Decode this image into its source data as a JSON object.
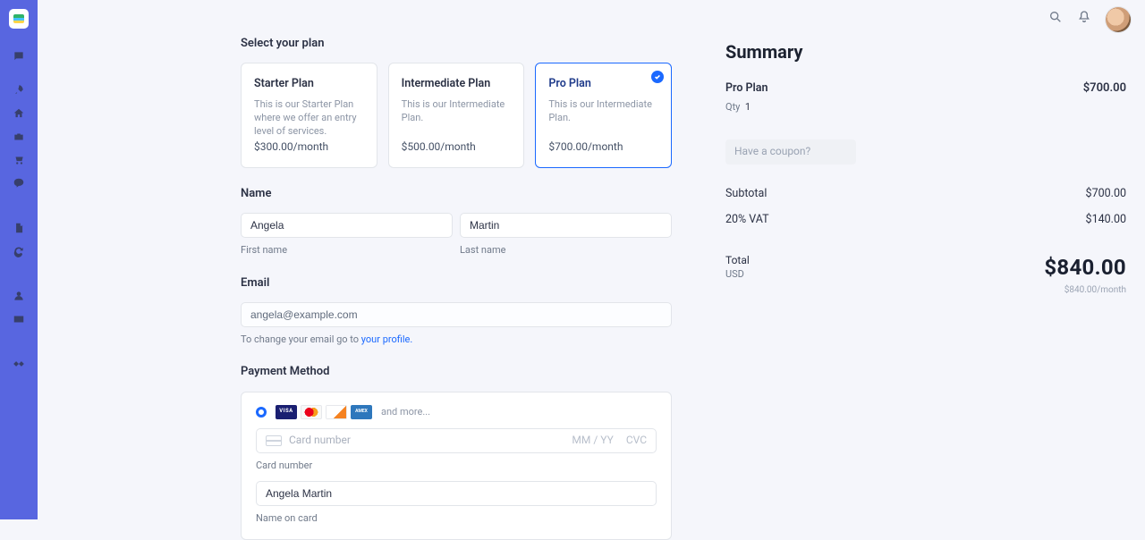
{
  "plan_section_title": "Select your plan",
  "plans": [
    {
      "title": "Starter Plan",
      "desc": "This is our Starter Plan where we offer an entry level of services.",
      "price": "$300.00/month",
      "selected": false
    },
    {
      "title": "Intermediate Plan",
      "desc": "This is our Intermediate Plan.",
      "price": "$500.00/month",
      "selected": false
    },
    {
      "title": "Pro Plan",
      "desc": "This is our Intermediate Plan.",
      "price": "$700.00/month",
      "selected": true
    }
  ],
  "name": {
    "heading": "Name",
    "first": "Angela",
    "last": "Martin",
    "first_label": "First name",
    "last_label": "Last name"
  },
  "email": {
    "heading": "Email",
    "value": "angela@example.com",
    "help_pre": "To change your email go to ",
    "help_link": "your profile.",
    "help_post": ""
  },
  "payment": {
    "heading": "Payment Method",
    "and_more": "and more...",
    "card_number_placeholder": "Card number",
    "mmyy": "MM / YY",
    "cvc": "CVC",
    "card_number_label": "Card number",
    "name_on_card_value": "Angela Martin",
    "name_on_card_label": "Name on card"
  },
  "summary": {
    "heading": "Summary",
    "item_name": "Pro Plan",
    "item_price": "$700.00",
    "qty_label": "Qty",
    "qty": "1",
    "coupon_placeholder": "Have a coupon?",
    "subtotal_label": "Subtotal",
    "subtotal": "$700.00",
    "vat_label": "20% VAT",
    "vat": "$140.00",
    "total_label": "Total",
    "currency": "USD",
    "total": "$840.00",
    "total_sub": "$840.00/month"
  }
}
